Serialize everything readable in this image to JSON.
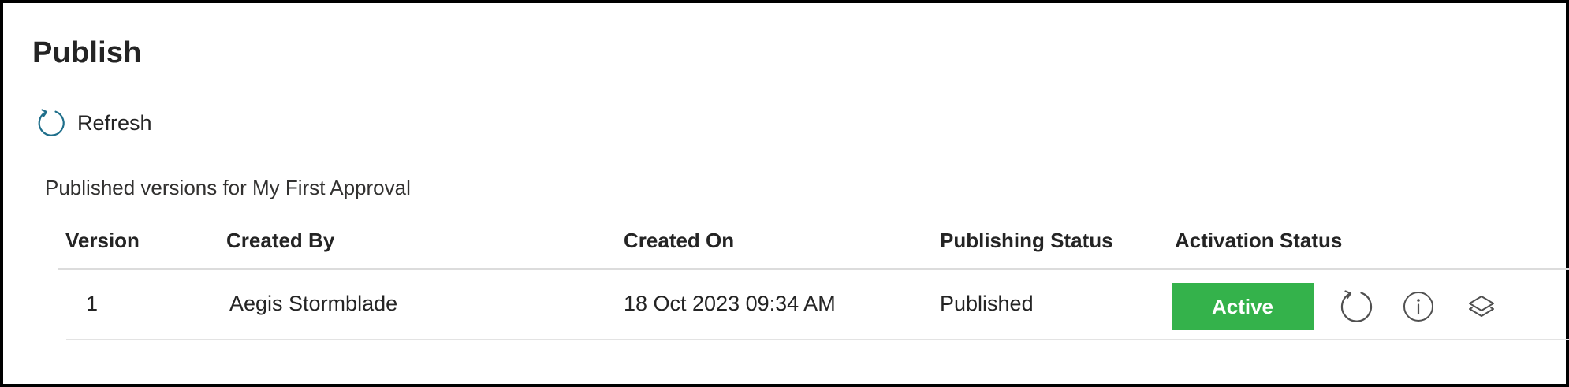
{
  "page": {
    "title": "Publish"
  },
  "toolbar": {
    "refresh_label": "Refresh",
    "refresh_icon": "refresh-icon"
  },
  "versions": {
    "caption": "Published versions for My First Approval",
    "columns": [
      "Version",
      "Created By",
      "Created On",
      "Publishing Status",
      "Activation Status"
    ],
    "rows": [
      {
        "version": "1",
        "created_by": "Aegis Stormblade",
        "created_on": "18 Oct 2023 09:34 AM",
        "publishing_status": "Published",
        "activation_status": "Active",
        "actions": [
          "refresh-icon",
          "info-icon",
          "layers-icon"
        ]
      }
    ]
  },
  "colors": {
    "accent_icon": "#1f6f8b",
    "active_green": "#34b24b",
    "icon_gray": "#505050"
  }
}
